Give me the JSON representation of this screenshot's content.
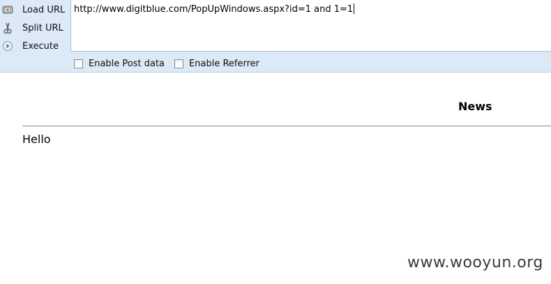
{
  "toolbar": {
    "load_url": "Load URL",
    "split_url": "Split URL",
    "execute": "Execute",
    "url_value": "http://www.digitblue.com/PopUpWindows.aspx?id=1 and 1=1",
    "enable_post_data": "Enable Post data",
    "enable_referrer": "Enable Referrer"
  },
  "page": {
    "heading": "News",
    "body_text": "Hello"
  },
  "watermark": "www.wooyun.org"
}
